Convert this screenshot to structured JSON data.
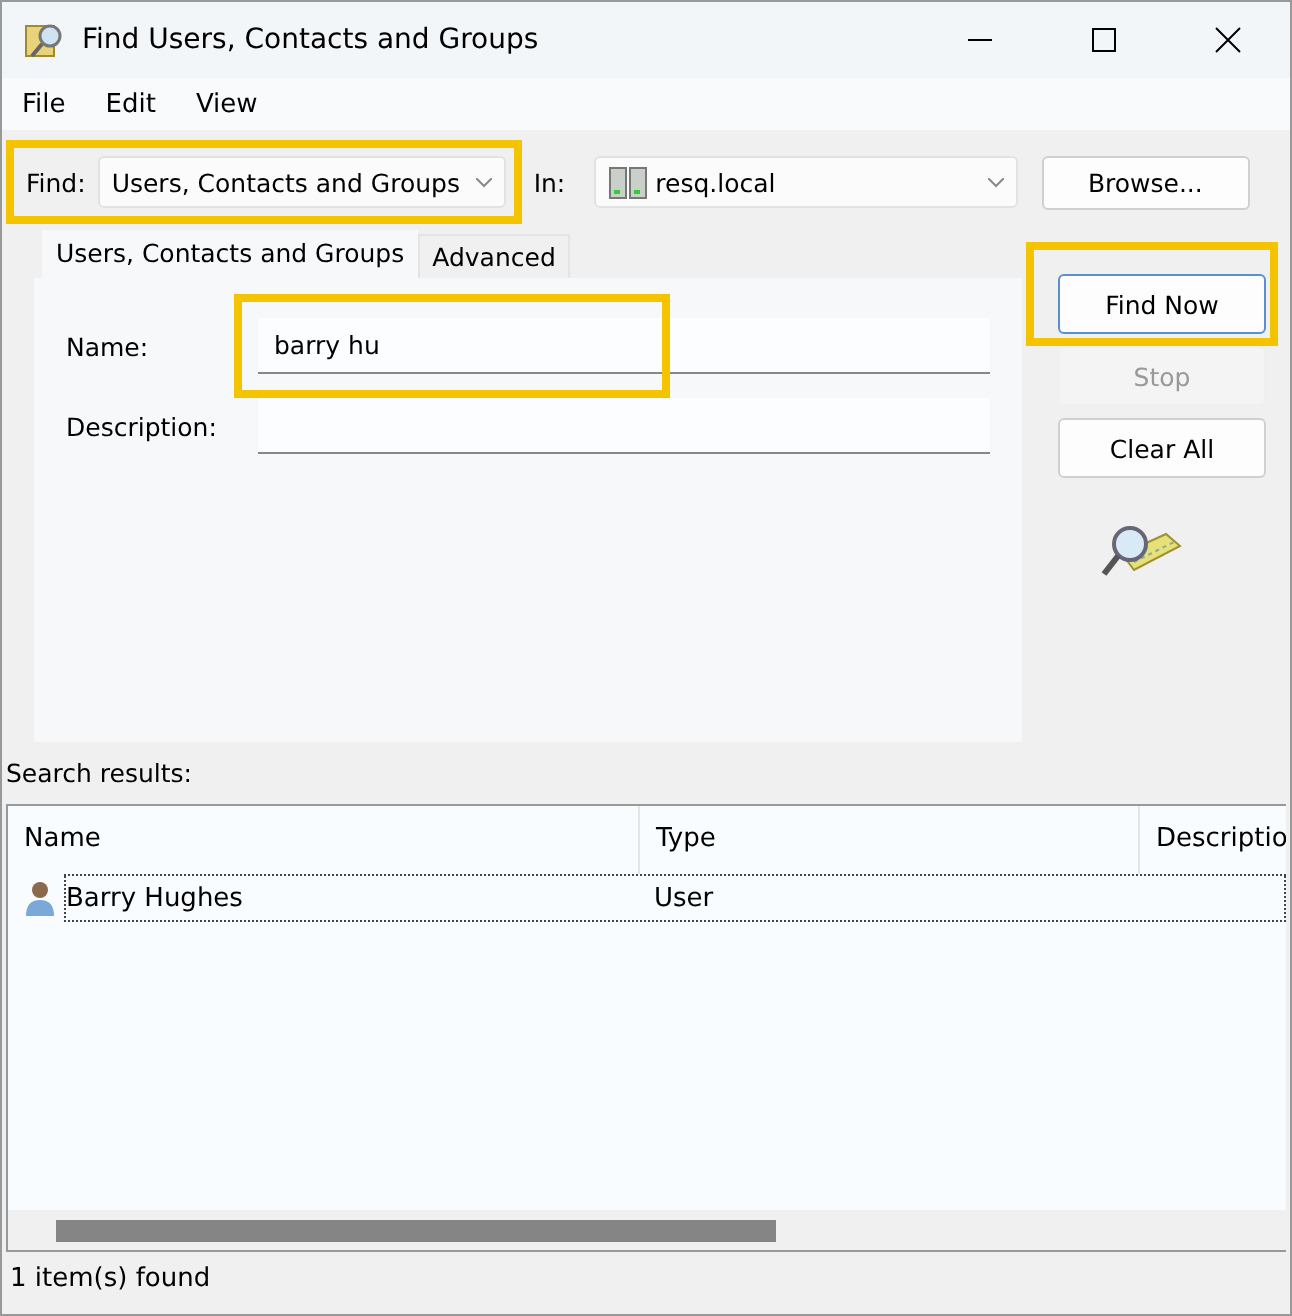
{
  "window": {
    "title": "Find Users, Contacts and Groups"
  },
  "menu": [
    "File",
    "Edit",
    "View"
  ],
  "find": {
    "label": "Find:",
    "value": "Users, Contacts and Groups",
    "highlighted": true
  },
  "in": {
    "label": "In:",
    "value": "resq.local"
  },
  "browse": "Browse...",
  "tabs": [
    {
      "label": "Users, Contacts and Groups",
      "selected": true
    },
    {
      "label": "Advanced",
      "selected": false
    }
  ],
  "fields": [
    {
      "label": "Name:",
      "value": "barry hu",
      "highlighted": true
    },
    {
      "label": "Description:",
      "highlighted": false
    }
  ],
  "buttons": [
    {
      "label": "Find Now",
      "disabled": false,
      "highlighted": true,
      "default": true
    },
    {
      "label": "Stop",
      "disabled": true,
      "highlighted": false,
      "default": false
    },
    {
      "label": "Clear All",
      "disabled": false,
      "highlighted": false,
      "default": false
    }
  ],
  "results": {
    "label": "Search results:",
    "columns": [
      "Name",
      "Type",
      "Descriptio"
    ],
    "rows": [
      {
        "name": "Barry Hughes",
        "type": "User",
        "selected": true
      }
    ]
  },
  "status_bar": "1 item(s) found"
}
